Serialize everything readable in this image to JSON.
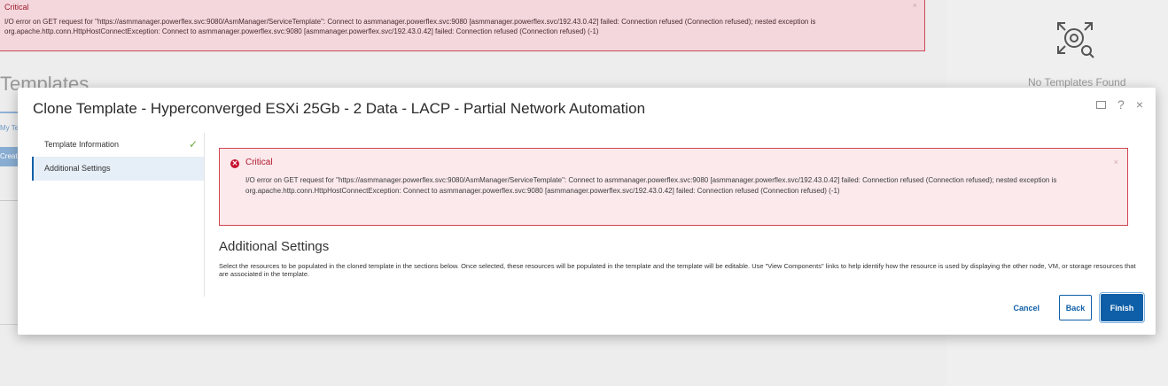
{
  "background": {
    "alert": {
      "title": "Critical",
      "message": "I/O error on GET request for \"https://asmmanager.powerflex.svc:9080/AsmManager/ServiceTemplate\": Connect to asmmanager.powerflex.svc:9080 [asmmanager.powerflex.svc/192.43.0.42] failed: Connection refused (Connection refused); nested exception is org.apache.http.conn.HttpHostConnectException: Connect to asmmanager.powerflex.svc:9080 [asmmanager.powerflex.svc/192.43.0.42] failed: Connection refused (Connection refused) (-1)",
      "close": "×"
    },
    "page_title": "Templates",
    "tab_label": "My Templates",
    "button_label": "Create",
    "empty_text": "No Templates Found"
  },
  "modal": {
    "title": "Clone Template - Hyperconverged ESXi 25Gb - 2 Data - LACP - Partial Network Automation",
    "controls": {
      "help": "?",
      "close": "×"
    },
    "steps": [
      {
        "label": "Template Information",
        "completed": true
      },
      {
        "label": "Additional Settings",
        "active": true
      }
    ],
    "check_glyph": "✓",
    "alert": {
      "icon_glyph": "✕",
      "title": "Critical",
      "message": "I/O error on GET request for \"https://asmmanager.powerflex.svc:9080/AsmManager/ServiceTemplate\": Connect to asmmanager.powerflex.svc:9080 [asmmanager.powerflex.svc/192.43.0.42] failed: Connection refused (Connection refused); nested exception is org.apache.http.conn.HttpHostConnectException: Connect to asmmanager.powerflex.svc:9080 [asmmanager.powerflex.svc/192.43.0.42] failed: Connection refused (Connection refused) (-1)",
      "close": "×"
    },
    "section_heading": "Additional Settings",
    "section_description": "Select the resources to be populated in the cloned template in the sections below. Once selected, these resources will be populated in the template and the template will be editable. Use \"View Components\" links to help identify how the resource is used by displaying the other node, VM, or storage resources that are associated in the template.",
    "buttons": {
      "cancel": "Cancel",
      "back": "Back",
      "finish": "Finish"
    }
  },
  "colors": {
    "accent": "#0e5fa8",
    "critical": "#c8102e",
    "success": "#6cab3d"
  }
}
